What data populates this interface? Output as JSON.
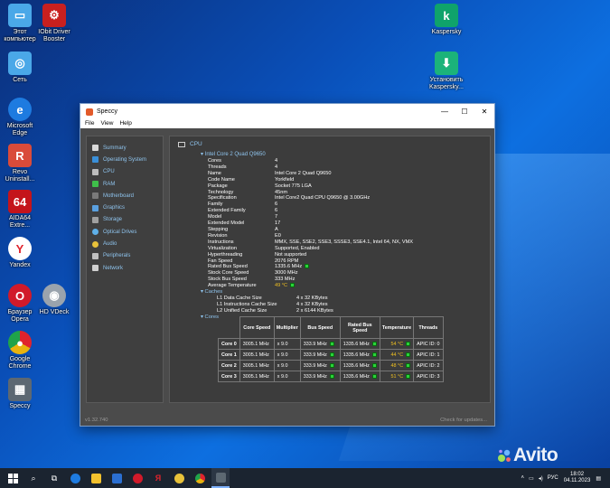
{
  "desktop": {
    "icons": [
      {
        "label": "Этот компьютер",
        "icon": "computer-icon",
        "color": "#4aa8e8"
      },
      {
        "label": "IObit Driver Booster",
        "icon": "driver-booster-icon",
        "color": "#c8201f"
      },
      {
        "label": "Kaspersky",
        "icon": "kaspersky-icon",
        "color": "#0fa36b"
      },
      {
        "label": "Сеть",
        "icon": "network-icon",
        "color": "#4aa8e8"
      },
      {
        "label": "Установить Kaspersky...",
        "icon": "kaspersky-install-icon",
        "color": "#1bb37a"
      },
      {
        "label": "Microsoft Edge",
        "icon": "edge-icon",
        "color": "#1e7be0"
      },
      {
        "label": "Revo Uninstall...",
        "icon": "revo-uninstaller-icon",
        "color": "#d94b3a"
      },
      {
        "label": "AIDA64 Extre...",
        "icon": "aida64-icon",
        "color": "#c4141b"
      },
      {
        "label": "Yandex",
        "icon": "yandex-icon",
        "color": "#e0232d"
      },
      {
        "label": "Браузер Opera",
        "icon": "opera-icon",
        "color": "#d11a2a"
      },
      {
        "label": "HD VDeck",
        "icon": "hd-vdeck-icon",
        "color": "#9aa3ad"
      },
      {
        "label": "Google Chrome",
        "icon": "chrome-icon",
        "color": "#e8b30f"
      },
      {
        "label": "Speccy",
        "icon": "speccy-icon",
        "color": "#5d6872"
      }
    ]
  },
  "window": {
    "title": "Speccy",
    "controls": {
      "minimize": "—",
      "maximize": "☐",
      "close": "✕"
    },
    "menu": [
      "File",
      "View",
      "Help"
    ],
    "sidebar": [
      {
        "label": "Summary",
        "color": "#d9d9d9"
      },
      {
        "label": "Operating System",
        "color": "#3a8fd8"
      },
      {
        "label": "CPU",
        "color": "#bdbdbd"
      },
      {
        "label": "RAM",
        "color": "#3fbf4a"
      },
      {
        "label": "Motherboard",
        "color": "#7a7a7a"
      },
      {
        "label": "Graphics",
        "color": "#5aa0e0"
      },
      {
        "label": "Storage",
        "color": "#a0a0a0"
      },
      {
        "label": "Optical Drives",
        "color": "#5fb0e8"
      },
      {
        "label": "Audio",
        "color": "#e8c23a"
      },
      {
        "label": "Peripherals",
        "color": "#c0c0c0"
      },
      {
        "label": "Network",
        "color": "#d0d0d0"
      }
    ],
    "section": "CPU",
    "processor": "Intel Core 2 Quad Q9650",
    "properties": [
      {
        "k": "Cores",
        "v": "4"
      },
      {
        "k": "Threads",
        "v": "4"
      },
      {
        "k": "Name",
        "v": "Intel Core 2 Quad Q9650"
      },
      {
        "k": "Code Name",
        "v": "Yorkfield"
      },
      {
        "k": "Package",
        "v": "Socket 775 LGA"
      },
      {
        "k": "Technology",
        "v": "45nm"
      },
      {
        "k": "Specification",
        "v": "Intel Core2 Quad CPU Q9650 @ 3.00GHz"
      },
      {
        "k": "Family",
        "v": "6"
      },
      {
        "k": "Extended Family",
        "v": "6"
      },
      {
        "k": "Model",
        "v": "7"
      },
      {
        "k": "Extended Model",
        "v": "17"
      },
      {
        "k": "Stepping",
        "v": "A"
      },
      {
        "k": "Revision",
        "v": "E0"
      },
      {
        "k": "Instructions",
        "v": "MMX, SSE, SSE2, SSE3, SSSE3, SSE4.1, Intel 64, NX, VMX"
      },
      {
        "k": "Virtualization",
        "v": "Supported, Enabled"
      },
      {
        "k": "Hyperthreading",
        "v": "Not supported"
      },
      {
        "k": "Fan Speed",
        "v": "2076 RPM"
      },
      {
        "k": "Rated Bus Speed",
        "v": "1335.6 MHz"
      },
      {
        "k": "Stock Core Speed",
        "v": "3000 MHz"
      },
      {
        "k": "Stock Bus Speed",
        "v": "333 MHz"
      },
      {
        "k": "Average Temperature",
        "v": "49 °C"
      }
    ],
    "caches_label": "Caches",
    "caches": [
      {
        "k": "L1 Data Cache Size",
        "v": "4 x 32 KBytes"
      },
      {
        "k": "L1 Instructions Cache Size",
        "v": "4 x 32 KBytes"
      },
      {
        "k": "L2 Unified Cache Size",
        "v": "2 x 6144 KBytes"
      }
    ],
    "cores_label": "Cores",
    "core_table": {
      "headers": [
        "",
        "Core Speed",
        "Multiplier",
        "Bus Speed",
        "Rated Bus Speed",
        "Temperature",
        "Threads"
      ],
      "rows": [
        {
          "name": "Core 0",
          "speed": "3005.1 MHz",
          "mult": "x 9.0",
          "bus": "333.9 MHz",
          "rated": "1335.6 MHz",
          "temp": "54 °C",
          "threads": "APIC ID: 0"
        },
        {
          "name": "Core 1",
          "speed": "3005.1 MHz",
          "mult": "x 9.0",
          "bus": "333.9 MHz",
          "rated": "1335.6 MHz",
          "temp": "44 °C",
          "threads": "APIC ID: 1"
        },
        {
          "name": "Core 2",
          "speed": "3005.1 MHz",
          "mult": "x 9.0",
          "bus": "333.9 MHz",
          "rated": "1335.6 MHz",
          "temp": "48 °C",
          "threads": "APIC ID: 2"
        },
        {
          "name": "Core 3",
          "speed": "3005.1 MHz",
          "mult": "x 9.0",
          "bus": "333.9 MHz",
          "rated": "1335.6 MHz",
          "temp": "51 °C",
          "threads": "APIC ID: 3"
        }
      ]
    },
    "version": "v1.32.740",
    "check_updates": "Check for updates..."
  },
  "taskbar": {
    "pinned": [
      {
        "icon": "windows-start-icon",
        "color": "#ffffff"
      },
      {
        "icon": "search-icon",
        "color": "#ffffff"
      },
      {
        "icon": "task-view-icon",
        "color": "#ffffff"
      },
      {
        "icon": "edge-icon",
        "color": "#1e7be0"
      },
      {
        "icon": "file-explorer-icon",
        "color": "#f2c12e"
      },
      {
        "icon": "store-icon",
        "color": "#2b6fd1"
      },
      {
        "icon": "opera-icon",
        "color": "#d11a2a"
      },
      {
        "icon": "yandex-icon",
        "color": "#e0232d"
      },
      {
        "icon": "hd-vdeck-icon",
        "color": "#e8c23a"
      },
      {
        "icon": "chrome-icon",
        "color": "#e8b30f"
      },
      {
        "icon": "speccy-icon",
        "color": "#5d6872"
      }
    ],
    "tray": {
      "lang": "РУС",
      "time": "18:02",
      "date": "04.11.2023"
    }
  },
  "watermark": "Avito"
}
